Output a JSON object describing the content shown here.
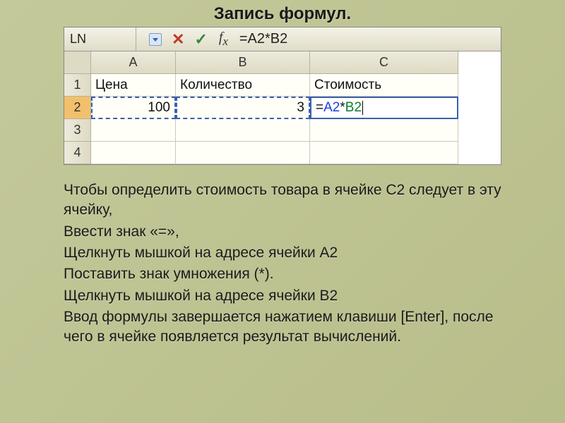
{
  "title": "Запись формул.",
  "formula_bar": {
    "name_box": "LN",
    "formula": "=A2*B2"
  },
  "grid": {
    "col_headers": [
      "A",
      "B",
      "C"
    ],
    "row_headers": [
      "1",
      "2",
      "3",
      "4"
    ],
    "cells": {
      "A1": "Цена",
      "B1": "Количество",
      "C1": "Стоимость",
      "A2": "100",
      "B2": "3",
      "C2_prefix": "=",
      "C2_refA": "A2",
      "C2_op": "*",
      "C2_refB": "B2"
    }
  },
  "body": {
    "p1": "Чтобы определить стоимость товара в ячейке C2 следует в эту ячейку,",
    "p2": "Ввести знак «=»,",
    "p3": "Щелкнуть мышкой на адресе ячейки А2",
    "p4": "Поставить знак умножения (*).",
    "p5": "Щелкнуть мышкой на адресе ячейки В2",
    "p6": "Ввод формулы завершается нажатием клавиши [Enter], после чего в ячейке появляется результат вычислений."
  }
}
